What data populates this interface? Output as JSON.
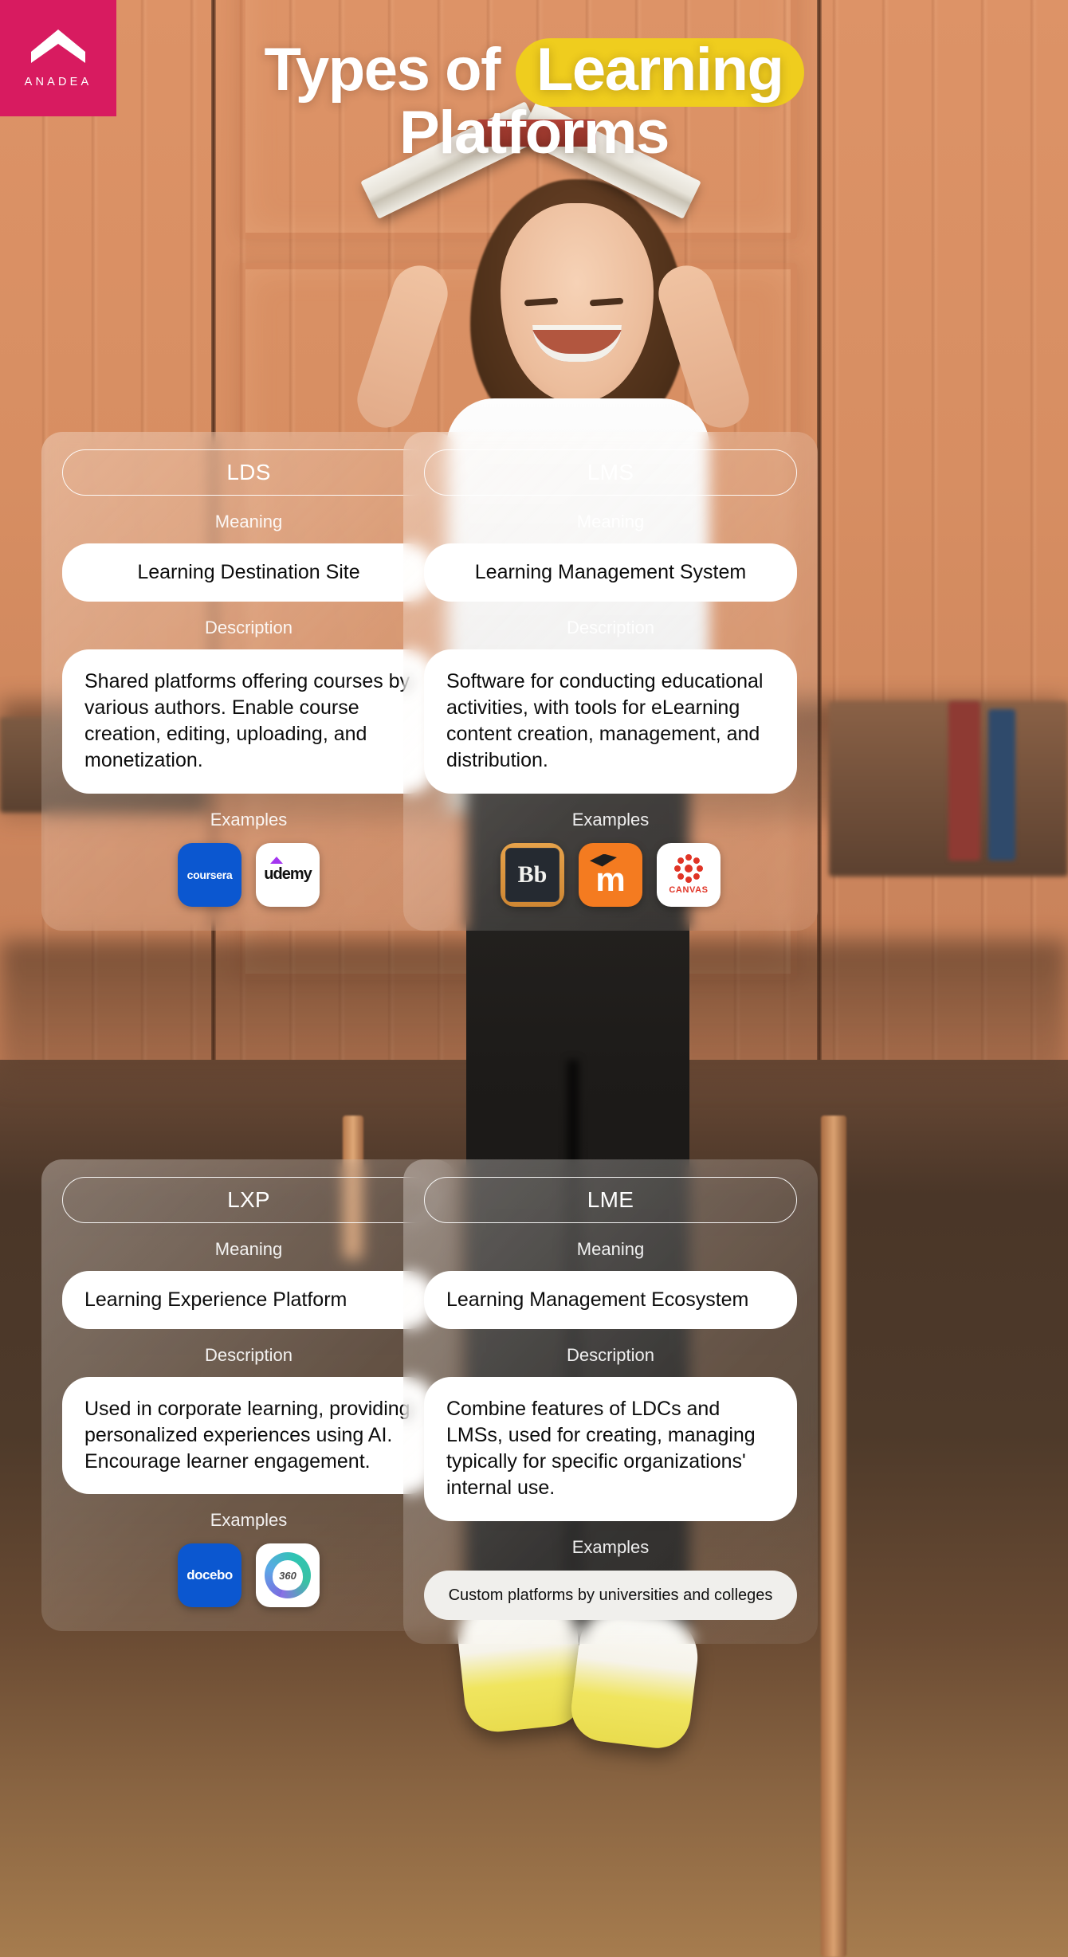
{
  "brand": {
    "name": "ANADEA",
    "badge_color": "#d81b60",
    "logo_icon": "chevron-roof-logo-icon"
  },
  "accent": {
    "yellow": "#efcd1e",
    "highlight_text_color": "#ffffff"
  },
  "headline": {
    "part1": "Types of",
    "highlight": "Learning",
    "part2": "Platforms"
  },
  "labels": {
    "meaning": "Meaning",
    "description": "Description",
    "examples": "Examples"
  },
  "cards": [
    {
      "id": "lds",
      "title": "LDS",
      "meaning": "Learning Destination Site",
      "meaning_align": "center",
      "description": "Shared platforms offering courses by various authors. Enable course creation, editing, uploading, and monetization.",
      "examples_type": "logos",
      "examples": [
        {
          "name": "coursera",
          "label": "coursera",
          "bg": "#0b57d0",
          "fg": "#ffffff"
        },
        {
          "name": "udemy",
          "label": "udemy",
          "bg": "#ffffff",
          "fg": "#111111",
          "accent": "#a435f0"
        }
      ]
    },
    {
      "id": "lms",
      "title": "LMS",
      "meaning": "Learning Management System",
      "meaning_align": "center",
      "description": "Software for conducting educational activities, with tools for eLearning content creation, management, and distribution.",
      "examples_type": "logos",
      "examples": [
        {
          "name": "blackboard",
          "label": "Bb",
          "bg": "#e6a24a",
          "fg": "#f2f2ef"
        },
        {
          "name": "moodle",
          "label": "m",
          "bg": "#f47b20",
          "fg": "#ffffff"
        },
        {
          "name": "canvas",
          "label": "CANVAS",
          "bg": "#ffffff",
          "fg": "#e03426"
        }
      ]
    },
    {
      "id": "lxp",
      "title": "LXP",
      "meaning": "Learning Experience Platform",
      "meaning_align": "left",
      "description": "Used in corporate learning, providing personalized experiences using AI. Encourage learner engagement.",
      "examples_type": "logos",
      "examples": [
        {
          "name": "docebo",
          "label": "docebo",
          "bg": "#0b57d0",
          "fg": "#ffffff"
        },
        {
          "name": "360learning",
          "label": "360",
          "bg": "#ffffff",
          "fg": "#4a4a4a"
        }
      ]
    },
    {
      "id": "lme",
      "title": "LME",
      "meaning": "Learning Management Ecosystem",
      "meaning_align": "left",
      "description": "Combine features of LDCs and LMSs, used for creating, managing typically for specific organizations' internal use.",
      "examples_type": "text",
      "examples_text": "Custom platforms by universities and colleges"
    }
  ]
}
